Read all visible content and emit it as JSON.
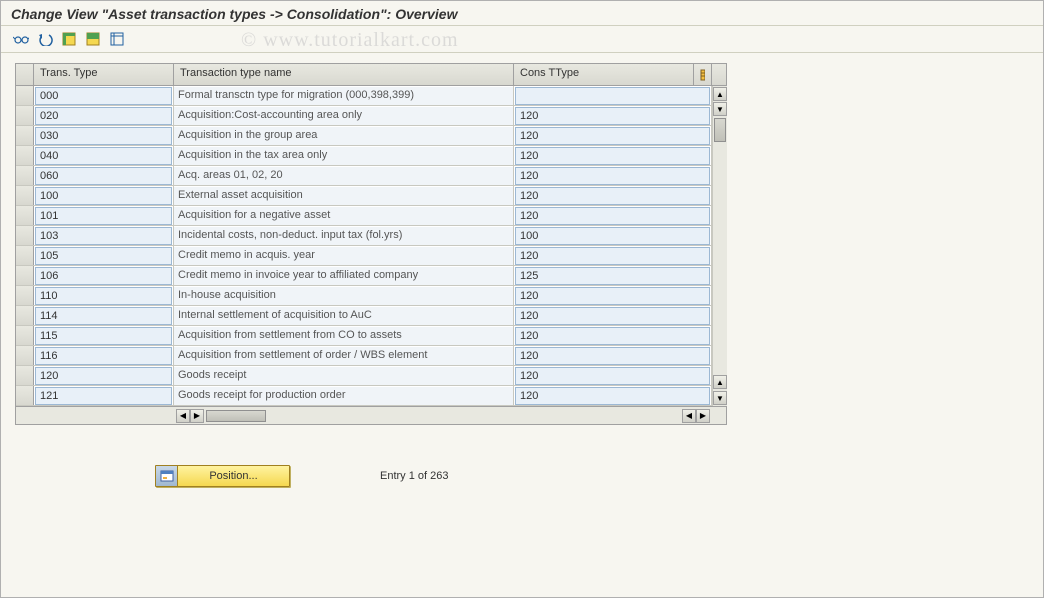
{
  "title": "Change View \"Asset transaction types -> Consolidation\": Overview",
  "watermark": "© www.tutorialkart.com",
  "columns": {
    "trans_type": "Trans. Type",
    "type_name": "Transaction type name",
    "cons_ttype": "Cons TType"
  },
  "rows": [
    {
      "type": "000",
      "name": "Formal transctn type for migration (000,398,399)",
      "cons": ""
    },
    {
      "type": "020",
      "name": "Acquisition:Cost-accounting area only",
      "cons": "120"
    },
    {
      "type": "030",
      "name": "Acquisition in the group area",
      "cons": "120"
    },
    {
      "type": "040",
      "name": "Acquisition in the tax area only",
      "cons": "120"
    },
    {
      "type": "060",
      "name": "Acq. areas 01, 02, 20",
      "cons": "120"
    },
    {
      "type": "100",
      "name": "External asset acquisition",
      "cons": "120"
    },
    {
      "type": "101",
      "name": "Acquisition for a negative asset",
      "cons": "120"
    },
    {
      "type": "103",
      "name": "Incidental costs, non-deduct. input tax (fol.yrs)",
      "cons": "100"
    },
    {
      "type": "105",
      "name": "Credit memo in acquis. year",
      "cons": "120"
    },
    {
      "type": "106",
      "name": "Credit memo in invoice year to affiliated company",
      "cons": "125"
    },
    {
      "type": "110",
      "name": "In-house acquisition",
      "cons": "120"
    },
    {
      "type": "114",
      "name": "Internal settlement of acquisition to AuC",
      "cons": "120"
    },
    {
      "type": "115",
      "name": "Acquisition from settlement from CO to assets",
      "cons": "120"
    },
    {
      "type": "116",
      "name": "Acquisition from settlement of order / WBS element",
      "cons": "120"
    },
    {
      "type": "120",
      "name": "Goods receipt",
      "cons": "120"
    },
    {
      "type": "121",
      "name": "Goods receipt for production order",
      "cons": "120"
    }
  ],
  "footer": {
    "position_label": "Position...",
    "entry_text": "Entry 1 of 263"
  }
}
